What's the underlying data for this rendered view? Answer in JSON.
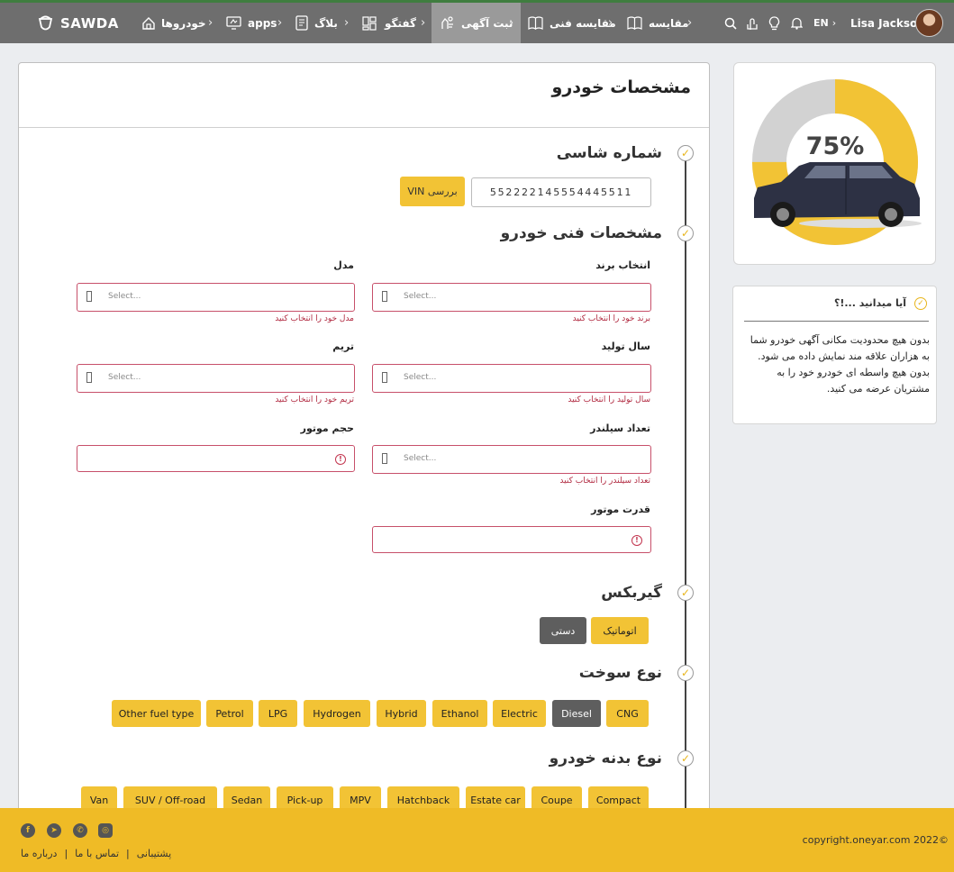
{
  "header": {
    "logo": "SAWDA",
    "nav": [
      {
        "label": "خودروها",
        "icon": "home-icon"
      },
      {
        "label": "apps",
        "icon": "apps-monitor-icon"
      },
      {
        "label": "بلاگ",
        "icon": "document-icon"
      },
      {
        "label": "گفتگو",
        "icon": "dashboard-icon"
      },
      {
        "label": "ثبت آگهی",
        "icon": "hand-car-icon",
        "active": true
      },
      {
        "label": "مقایسه فنی",
        "icon": "book-icon"
      },
      {
        "label": "مقایسه",
        "icon": "book-icon"
      }
    ],
    "language": "EN",
    "user_name": "Lisa Jackson"
  },
  "main": {
    "title": "مشخصات خودرو",
    "vin": {
      "title": "شماره شاسی",
      "value": "552222145554445511",
      "button_label": "بررسی VIN"
    },
    "specs": {
      "title": "مشخصات فنی خودرو",
      "placeholder": "Select...",
      "fields": {
        "brand": {
          "label": "انتخاب برند",
          "error": "برند خود را انتخاب کنید"
        },
        "model": {
          "label": "مدل",
          "error": "مدل خود را انتخاب کنید"
        },
        "year": {
          "label": "سال تولید",
          "error": "سال تولید را انتخاب کنید"
        },
        "trim": {
          "label": "تریم",
          "error": "تریم خود را انتخاب کنید"
        },
        "cylinders": {
          "label": "تعداد سیلندر",
          "error": "تعداد سیلندر را انتخاب کنید"
        },
        "engine_volume": {
          "label": "حجم موتور"
        },
        "engine_power": {
          "label": "قدرت موتور"
        }
      }
    },
    "gearbox": {
      "title": "گیربکس",
      "options": [
        "اتوماتیک",
        "دستی"
      ],
      "selected": "دستی"
    },
    "fuel": {
      "title": "نوع سوخت",
      "options": [
        "CNG",
        "Diesel",
        "Electric",
        "Ethanol",
        "Hybrid",
        "Hydrogen",
        "LPG",
        "Petrol",
        "Other fuel type"
      ],
      "selected": "Diesel"
    },
    "body": {
      "title": "نوع بدنه خودرو",
      "options": [
        "Compact",
        "Coupe",
        "Estate car",
        "Hatchback",
        "MPV",
        "Pick-up",
        "Sedan",
        "SUV / Off-road",
        "Van"
      ]
    }
  },
  "side": {
    "progress_label": "75%",
    "progress_value": 0.75,
    "tip_title": "آیا میدانید ...!؟",
    "tip_text": "بدون هیچ محدودیت مکانی آگهی خودرو شما به هزاران علاقه مند نمایش داده می شود. بدون هیچ واسطه ای خودرو خود را به مشتریان عرضه می کنید."
  },
  "footer": {
    "links": [
      "پشتیبانی",
      "|",
      "تماس با ما",
      "|",
      "درباره ما"
    ],
    "copyright": "copyright.oneyar.com 2022©"
  },
  "colors": {
    "accent": "#f2c335",
    "footer": "#efbb26",
    "header": "#6e6e6e",
    "error": "#b0283f",
    "selected_chip": "#5e5e5e"
  }
}
